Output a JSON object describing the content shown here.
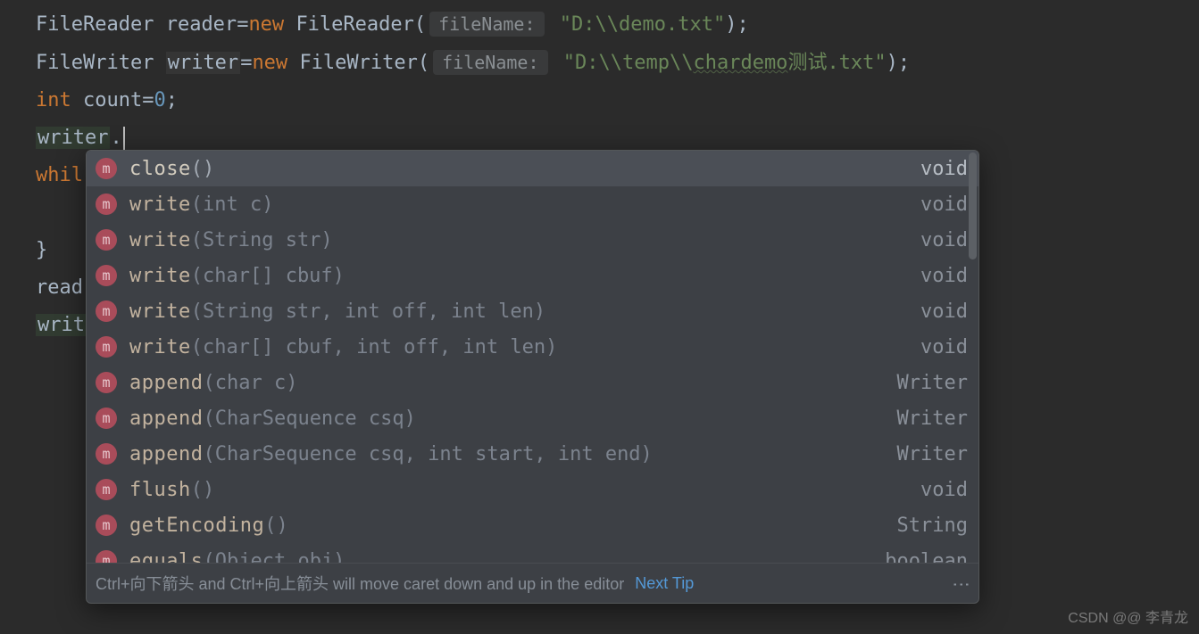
{
  "code": {
    "line1_type": "FileReader",
    "line1_var": "reader",
    "line1_new": "new",
    "line1_class": "FileReader",
    "line1_hint": "fileName:",
    "line1_string": "\"D:\\\\demo.txt\"",
    "line2_type": "FileWriter",
    "line2_var": "writer",
    "line2_new": "new",
    "line2_class": "FileWriter",
    "line2_hint": "fileName:",
    "line2_str_a": "\"D:\\\\temp\\\\",
    "line2_str_b": "chardemo",
    "line2_str_c": "测试.txt\"",
    "line3_int": "int",
    "line3_var": "count",
    "line3_num": "0",
    "line4_var": "writer",
    "line5_while": "whil",
    "line7_brace": "}",
    "line8_prefix": "read",
    "line9_prefix": "writ"
  },
  "suggestions": [
    {
      "name": "close",
      "params": "()",
      "ret": "void",
      "selected": true
    },
    {
      "name": "write",
      "params": "(int c)",
      "ret": "void"
    },
    {
      "name": "write",
      "params": "(String str)",
      "ret": "void"
    },
    {
      "name": "write",
      "params": "(char[] cbuf)",
      "ret": "void"
    },
    {
      "name": "write",
      "params": "(String str, int off, int len)",
      "ret": "void"
    },
    {
      "name": "write",
      "params": "(char[] cbuf, int off, int len)",
      "ret": "void"
    },
    {
      "name": "append",
      "params": "(char c)",
      "ret": "Writer"
    },
    {
      "name": "append",
      "params": "(CharSequence csq)",
      "ret": "Writer"
    },
    {
      "name": "append",
      "params": "(CharSequence csq, int start, int end)",
      "ret": "Writer"
    },
    {
      "name": "flush",
      "params": "()",
      "ret": "void"
    },
    {
      "name": "getEncoding",
      "params": "()",
      "ret": "String"
    },
    {
      "name": "equals",
      "params": "(Object obj)",
      "ret": "boolean"
    }
  ],
  "footer": {
    "tip": "Ctrl+向下箭头 and Ctrl+向上箭头 will move caret down and up in the editor",
    "next": "Next Tip"
  },
  "watermark": "CSDN @@ 李青龙",
  "icon_letter": "m",
  "more_glyph": "⋮"
}
